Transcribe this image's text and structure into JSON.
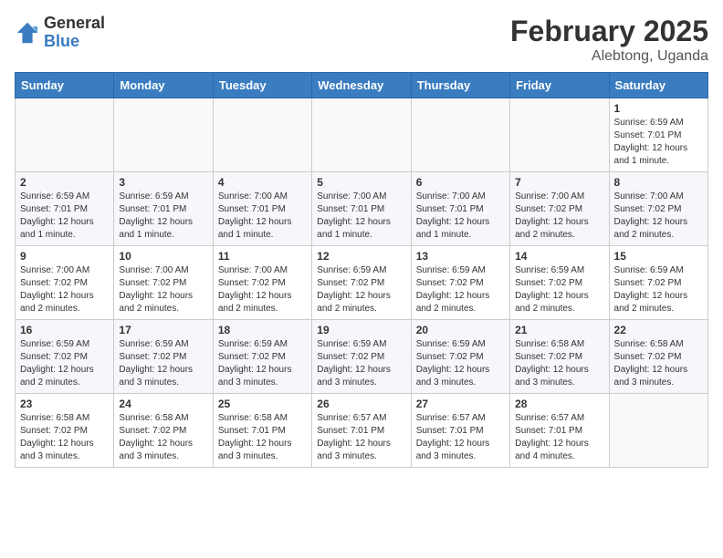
{
  "header": {
    "logo_general": "General",
    "logo_blue": "Blue",
    "month_year": "February 2025",
    "location": "Alebtong, Uganda"
  },
  "days_of_week": [
    "Sunday",
    "Monday",
    "Tuesday",
    "Wednesday",
    "Thursday",
    "Friday",
    "Saturday"
  ],
  "weeks": [
    [
      {
        "day": "",
        "info": ""
      },
      {
        "day": "",
        "info": ""
      },
      {
        "day": "",
        "info": ""
      },
      {
        "day": "",
        "info": ""
      },
      {
        "day": "",
        "info": ""
      },
      {
        "day": "",
        "info": ""
      },
      {
        "day": "1",
        "info": "Sunrise: 6:59 AM\nSunset: 7:01 PM\nDaylight: 12 hours and 1 minute."
      }
    ],
    [
      {
        "day": "2",
        "info": "Sunrise: 6:59 AM\nSunset: 7:01 PM\nDaylight: 12 hours and 1 minute."
      },
      {
        "day": "3",
        "info": "Sunrise: 6:59 AM\nSunset: 7:01 PM\nDaylight: 12 hours and 1 minute."
      },
      {
        "day": "4",
        "info": "Sunrise: 7:00 AM\nSunset: 7:01 PM\nDaylight: 12 hours and 1 minute."
      },
      {
        "day": "5",
        "info": "Sunrise: 7:00 AM\nSunset: 7:01 PM\nDaylight: 12 hours and 1 minute."
      },
      {
        "day": "6",
        "info": "Sunrise: 7:00 AM\nSunset: 7:01 PM\nDaylight: 12 hours and 1 minute."
      },
      {
        "day": "7",
        "info": "Sunrise: 7:00 AM\nSunset: 7:02 PM\nDaylight: 12 hours and 2 minutes."
      },
      {
        "day": "8",
        "info": "Sunrise: 7:00 AM\nSunset: 7:02 PM\nDaylight: 12 hours and 2 minutes."
      }
    ],
    [
      {
        "day": "9",
        "info": "Sunrise: 7:00 AM\nSunset: 7:02 PM\nDaylight: 12 hours and 2 minutes."
      },
      {
        "day": "10",
        "info": "Sunrise: 7:00 AM\nSunset: 7:02 PM\nDaylight: 12 hours and 2 minutes."
      },
      {
        "day": "11",
        "info": "Sunrise: 7:00 AM\nSunset: 7:02 PM\nDaylight: 12 hours and 2 minutes."
      },
      {
        "day": "12",
        "info": "Sunrise: 6:59 AM\nSunset: 7:02 PM\nDaylight: 12 hours and 2 minutes."
      },
      {
        "day": "13",
        "info": "Sunrise: 6:59 AM\nSunset: 7:02 PM\nDaylight: 12 hours and 2 minutes."
      },
      {
        "day": "14",
        "info": "Sunrise: 6:59 AM\nSunset: 7:02 PM\nDaylight: 12 hours and 2 minutes."
      },
      {
        "day": "15",
        "info": "Sunrise: 6:59 AM\nSunset: 7:02 PM\nDaylight: 12 hours and 2 minutes."
      }
    ],
    [
      {
        "day": "16",
        "info": "Sunrise: 6:59 AM\nSunset: 7:02 PM\nDaylight: 12 hours and 2 minutes."
      },
      {
        "day": "17",
        "info": "Sunrise: 6:59 AM\nSunset: 7:02 PM\nDaylight: 12 hours and 3 minutes."
      },
      {
        "day": "18",
        "info": "Sunrise: 6:59 AM\nSunset: 7:02 PM\nDaylight: 12 hours and 3 minutes."
      },
      {
        "day": "19",
        "info": "Sunrise: 6:59 AM\nSunset: 7:02 PM\nDaylight: 12 hours and 3 minutes."
      },
      {
        "day": "20",
        "info": "Sunrise: 6:59 AM\nSunset: 7:02 PM\nDaylight: 12 hours and 3 minutes."
      },
      {
        "day": "21",
        "info": "Sunrise: 6:58 AM\nSunset: 7:02 PM\nDaylight: 12 hours and 3 minutes."
      },
      {
        "day": "22",
        "info": "Sunrise: 6:58 AM\nSunset: 7:02 PM\nDaylight: 12 hours and 3 minutes."
      }
    ],
    [
      {
        "day": "23",
        "info": "Sunrise: 6:58 AM\nSunset: 7:02 PM\nDaylight: 12 hours and 3 minutes."
      },
      {
        "day": "24",
        "info": "Sunrise: 6:58 AM\nSunset: 7:02 PM\nDaylight: 12 hours and 3 minutes."
      },
      {
        "day": "25",
        "info": "Sunrise: 6:58 AM\nSunset: 7:01 PM\nDaylight: 12 hours and 3 minutes."
      },
      {
        "day": "26",
        "info": "Sunrise: 6:57 AM\nSunset: 7:01 PM\nDaylight: 12 hours and 3 minutes."
      },
      {
        "day": "27",
        "info": "Sunrise: 6:57 AM\nSunset: 7:01 PM\nDaylight: 12 hours and 3 minutes."
      },
      {
        "day": "28",
        "info": "Sunrise: 6:57 AM\nSunset: 7:01 PM\nDaylight: 12 hours and 4 minutes."
      },
      {
        "day": "",
        "info": ""
      }
    ]
  ]
}
